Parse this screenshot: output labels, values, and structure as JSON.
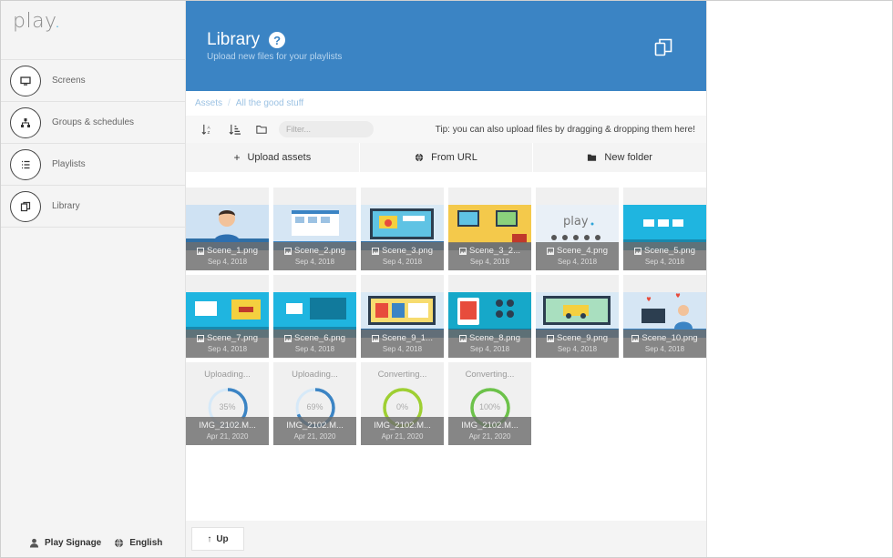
{
  "app": {
    "logo_text": "play",
    "logo_dot": "."
  },
  "sidebar": {
    "items": [
      {
        "label": "Screens",
        "icon": "monitor-icon"
      },
      {
        "label": "Groups & schedules",
        "icon": "hierarchy-icon"
      },
      {
        "label": "Playlists",
        "icon": "list-icon"
      },
      {
        "label": "Library",
        "icon": "library-icon"
      }
    ],
    "footer": {
      "account": "Play Signage",
      "language": "English"
    }
  },
  "header": {
    "title": "Library",
    "subtitle": "Upload new files for your playlists",
    "help": "?"
  },
  "breadcrumb": {
    "root": "Assets",
    "sep": "/",
    "current": "All the good stuff"
  },
  "toolbar": {
    "filter_placeholder": "Filter...",
    "tip": "Tip: you can also upload files by dragging & dropping them here!"
  },
  "actions": {
    "upload": "Upload assets",
    "from_url": "From URL",
    "new_folder": "New folder"
  },
  "assets": [
    {
      "name": "Scene_1.png",
      "date": "Sep 4, 2018",
      "thumb": "person"
    },
    {
      "name": "Scene_2.png",
      "date": "Sep 4, 2018",
      "thumb": "ui-panel"
    },
    {
      "name": "Scene_3.png",
      "date": "Sep 4, 2018",
      "thumb": "screens"
    },
    {
      "name": "Scene_3_2...",
      "date": "Sep 4, 2018",
      "thumb": "room-yellow"
    },
    {
      "name": "Scene_4.png",
      "date": "Sep 4, 2018",
      "thumb": "play-logo"
    },
    {
      "name": "Scene_5.png",
      "date": "Sep 4, 2018",
      "thumb": "monitors-cyan"
    },
    {
      "name": "Scene_7.png",
      "date": "Sep 4, 2018",
      "thumb": "cyan-car"
    },
    {
      "name": "Scene_6.png",
      "date": "Sep 4, 2018",
      "thumb": "cyan-screens"
    },
    {
      "name": "Scene_9_1...",
      "date": "Sep 4, 2018",
      "thumb": "screens"
    },
    {
      "name": "Scene_8.png",
      "date": "Sep 4, 2018",
      "thumb": "teal-devices"
    },
    {
      "name": "Scene_9.png",
      "date": "Sep 4, 2018",
      "thumb": "screens-blue"
    },
    {
      "name": "Scene_10.png",
      "date": "Sep 4, 2018",
      "thumb": "person-desk"
    }
  ],
  "processing": [
    {
      "status": "Uploading...",
      "progress": "35%",
      "progress_value": 0.35,
      "name": "IMG_2102.M...",
      "date": "Apr 21, 2020",
      "color": "#3b84c4"
    },
    {
      "status": "Uploading...",
      "progress": "69%",
      "progress_value": 0.69,
      "name": "IMG_2102.M...",
      "date": "Apr 21, 2020",
      "color": "#3b84c4"
    },
    {
      "status": "Converting...",
      "progress": "0%",
      "progress_value": 1.0,
      "name": "IMG_2102.M...",
      "date": "Apr 21, 2020",
      "color": "#9ecf32"
    },
    {
      "status": "Converting...",
      "progress": "100%",
      "progress_value": 1.0,
      "name": "IMG_2102.M...",
      "date": "Apr 21, 2020",
      "color": "#6cc24a"
    }
  ],
  "bottom": {
    "up_label": "Up"
  },
  "colors": {
    "header": "#3b84c4",
    "accent": "#2fa4d8"
  }
}
